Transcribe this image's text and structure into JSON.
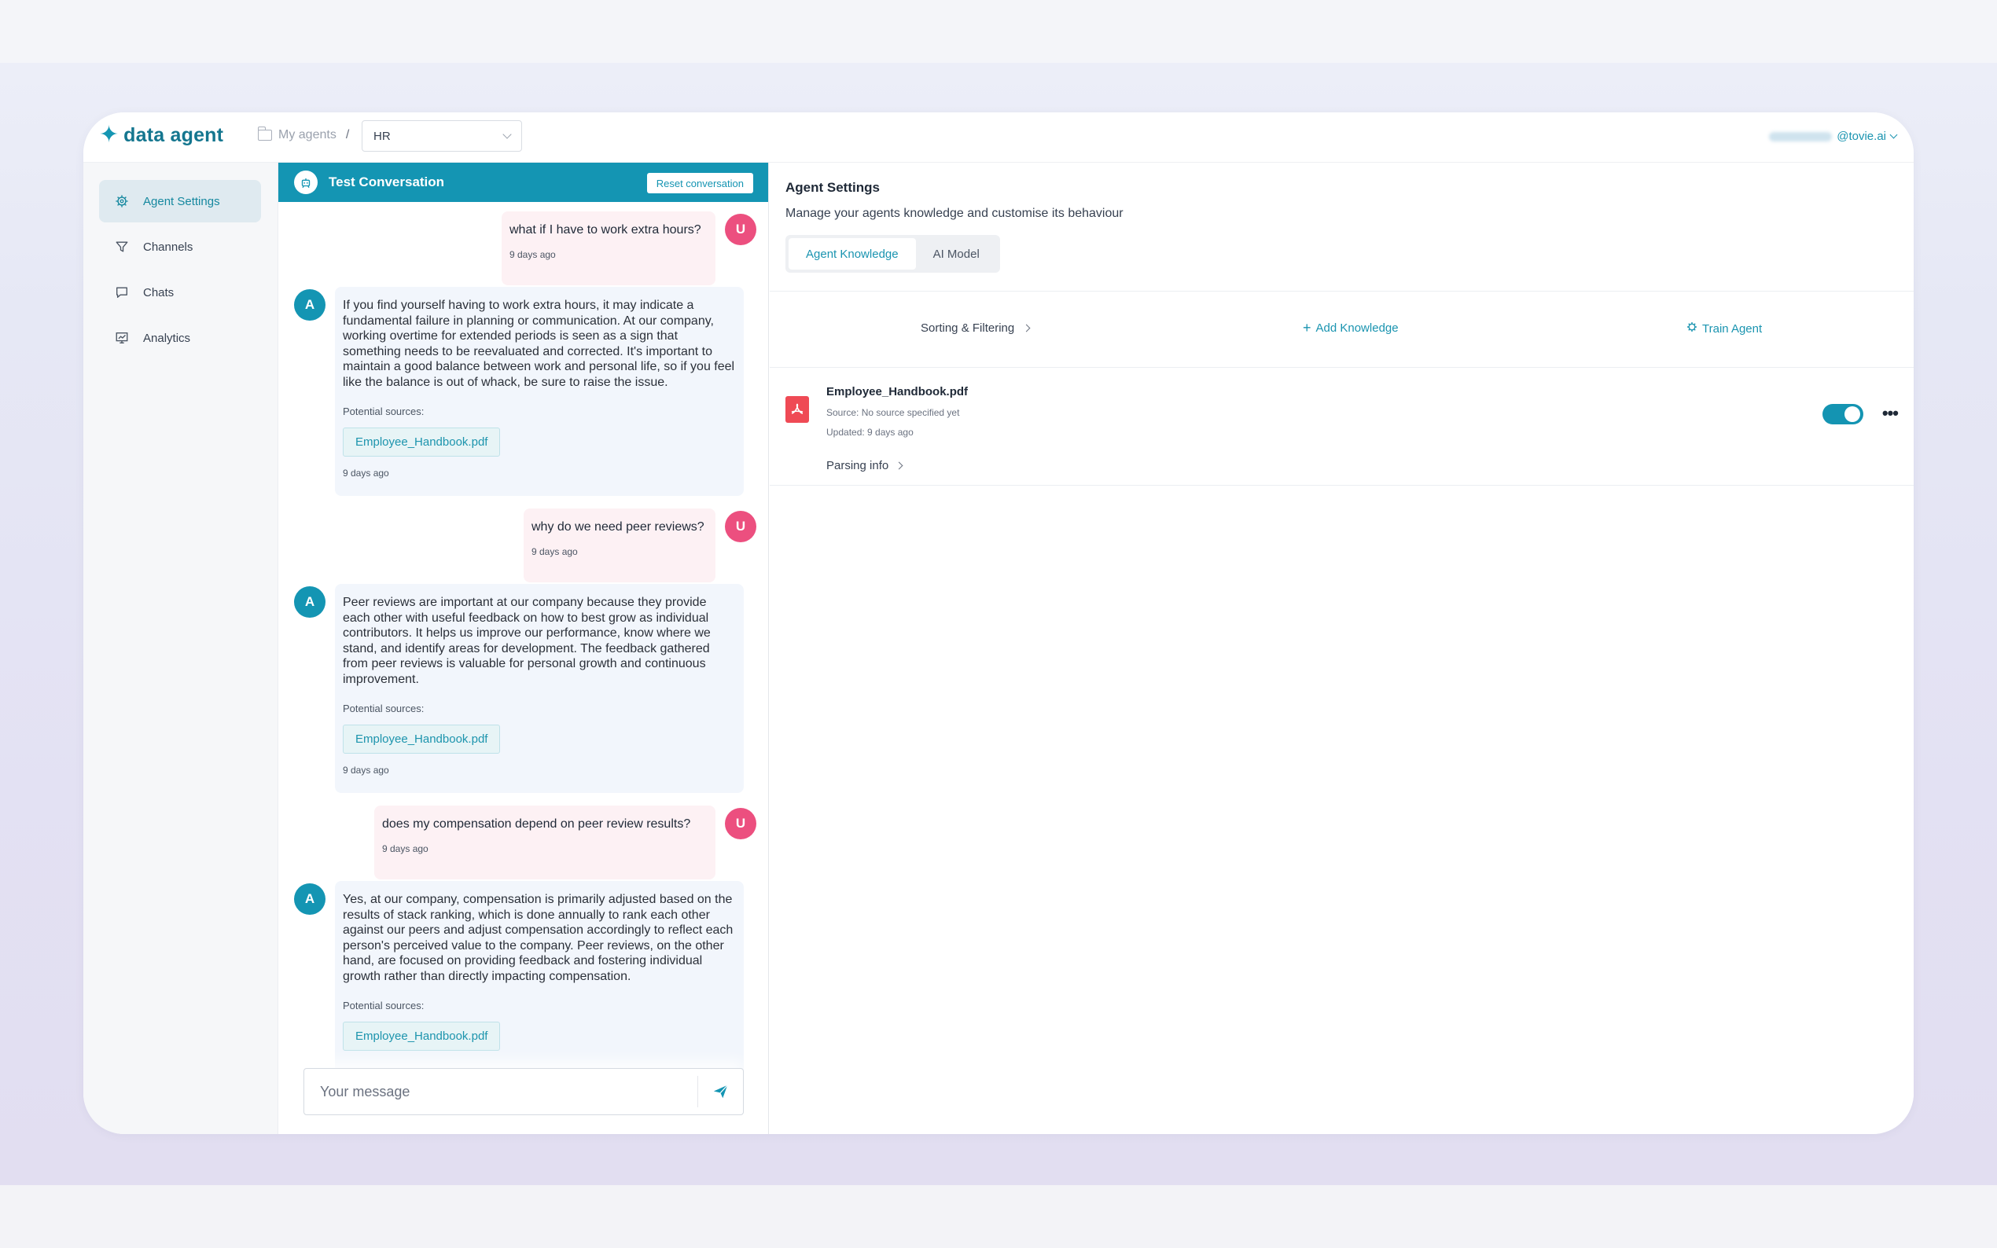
{
  "header": {
    "logo_text": "data agent",
    "breadcrumb_root": "My agents",
    "breadcrumb_sep": "/",
    "agent_selected": "HR",
    "account_domain": "@tovie.ai"
  },
  "sidebar": {
    "items": [
      {
        "label": "Agent Settings",
        "icon": "gear-icon",
        "active": true
      },
      {
        "label": "Channels",
        "icon": "funnel-icon",
        "active": false
      },
      {
        "label": "Chats",
        "icon": "chat-icon",
        "active": false
      },
      {
        "label": "Analytics",
        "icon": "chart-icon",
        "active": false
      }
    ]
  },
  "chat": {
    "title": "Test Conversation",
    "reset_label": "Reset conversation",
    "user_initial": "U",
    "agent_initial": "A",
    "sources_label": "Potential sources:",
    "messages": [
      {
        "role": "user",
        "text": "what if I have to work extra hours?",
        "time": "9 days ago"
      },
      {
        "role": "agent",
        "text": "If you find yourself having to work extra hours, it may indicate a fundamental failure in planning or communication. At our company, working overtime for extended periods is seen as a sign that something needs to be reevaluated and corrected. It's important to maintain a good balance between work and personal life, so if you feel like the balance is out of whack, be sure to raise the issue.",
        "source": "Employee_Handbook.pdf",
        "time": "9 days ago"
      },
      {
        "role": "user",
        "text": "why do we need peer reviews?",
        "time": "9 days ago"
      },
      {
        "role": "agent",
        "text": "Peer reviews are important at our company because they provide each other with useful feedback on how to best grow as individual contributors. It helps us improve our performance, know where we stand, and identify areas for development. The feedback gathered from peer reviews is valuable for personal growth and continuous improvement.",
        "source": "Employee_Handbook.pdf",
        "time": "9 days ago"
      },
      {
        "role": "user",
        "text": "does my compensation depend on peer review results?",
        "time": "9 days ago"
      },
      {
        "role": "agent",
        "text": "Yes, at our company, compensation is primarily adjusted based on the results of stack ranking, which is done annually to rank each other against our peers and adjust compensation accordingly to reflect each person's perceived value to the company. Peer reviews, on the other hand, are focused on providing feedback and fostering individual growth rather than directly impacting compensation.",
        "source": "Employee_Handbook.pdf"
      }
    ],
    "composer_placeholder": "Your message"
  },
  "panel": {
    "title": "Agent Settings",
    "subtitle": "Manage your agents knowledge and customise its behaviour",
    "tabs": [
      {
        "label": "Agent Knowledge",
        "active": true
      },
      {
        "label": "AI Model",
        "active": false
      }
    ],
    "toolbar": {
      "sort_label": "Sorting & Filtering",
      "add_label": "Add Knowledge",
      "train_label": "Train Agent"
    },
    "documents": [
      {
        "name": "Employee_Handbook.pdf",
        "source": "Source: No source specified yet",
        "updated": "Updated: 9 days ago",
        "parsing_label": "Parsing info",
        "enabled": true
      }
    ]
  },
  "colors": {
    "accent": "#1495b3",
    "user_avatar": "#ec4f7f",
    "pdf_icon": "#ef4a55"
  }
}
